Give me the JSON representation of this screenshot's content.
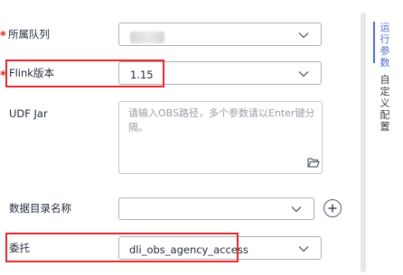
{
  "form": {
    "queue": {
      "label": "所属队列",
      "required": true,
      "value": ""
    },
    "flink_version": {
      "label": "Flink版本",
      "required": true,
      "value": "1.15"
    },
    "udf_jar": {
      "label": "UDF Jar",
      "placeholder": "请输入OBS路径，多个参数请以Enter键分隔。"
    },
    "catalog_name": {
      "label": "数据目录名称",
      "value": ""
    },
    "agency": {
      "label": "委托",
      "value": "dli_obs_agency_access"
    }
  },
  "side_tabs": [
    {
      "label": "运行参数",
      "active": true
    },
    {
      "label": "自定义配置",
      "active": false
    }
  ],
  "required_mark": "*",
  "colors": {
    "accent": "#526ecc",
    "highlight_border": "#e8262c",
    "required": "#e5221f"
  },
  "icons": {
    "select_arrow": "chevron-down-icon",
    "textarea_upload": "folder-open-icon",
    "add": "plus-icon"
  }
}
